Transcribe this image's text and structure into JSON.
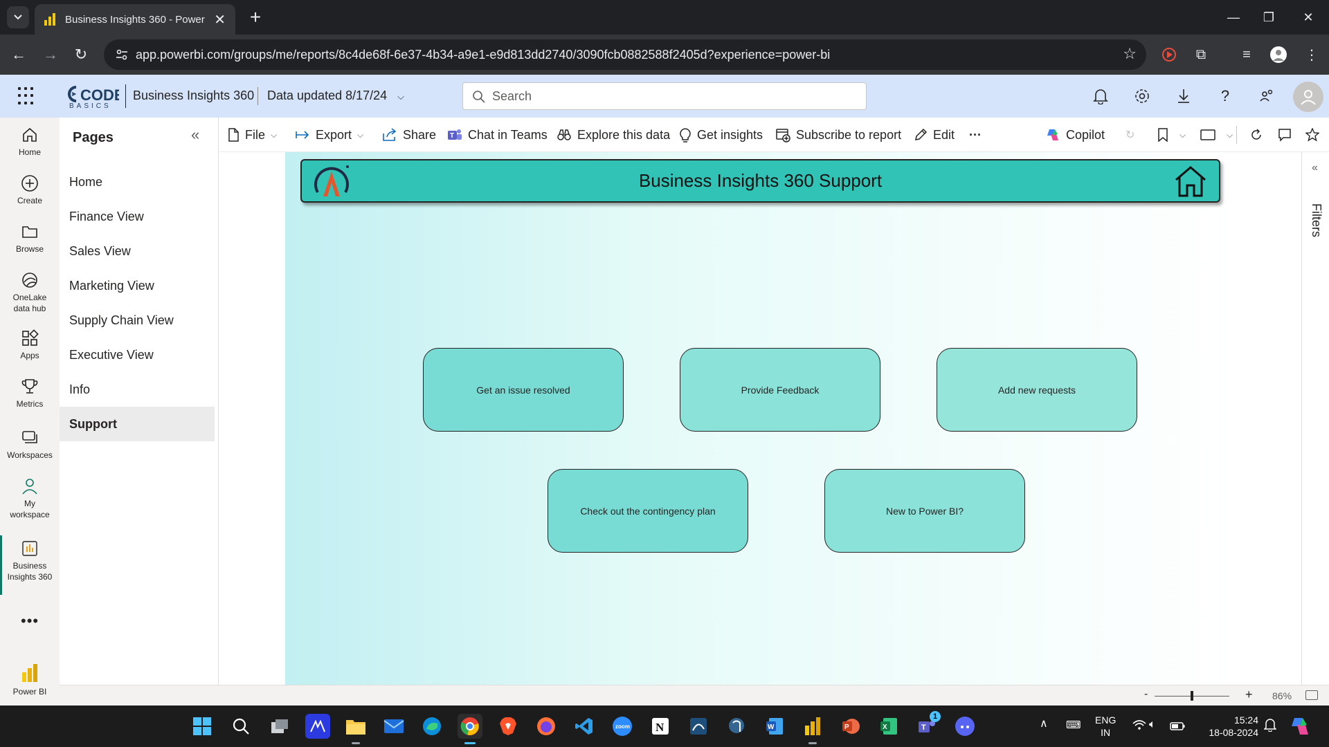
{
  "browser": {
    "tab_title": "Business Insights 360 - Power BI",
    "url": "app.powerbi.com/groups/me/reports/8c4de68f-6e37-4b34-a9e1-e9d813dd2740/3090fcb0882588f2405d?experience=power-bi"
  },
  "header": {
    "brand_text": "CODE",
    "brand_sub": "BASICS",
    "workspace_name": "Business Insights 360",
    "data_updated": "Data updated 8/17/24",
    "search_placeholder": "Search"
  },
  "navrail": {
    "items": [
      {
        "label": "Home",
        "icon": "home-icon"
      },
      {
        "label": "Create",
        "icon": "plus-circle-icon"
      },
      {
        "label": "Browse",
        "icon": "folder-icon"
      },
      {
        "label": "OneLake data hub",
        "icon": "onelake-icon"
      },
      {
        "label": "Apps",
        "icon": "apps-icon"
      },
      {
        "label": "Metrics",
        "icon": "trophy-icon"
      },
      {
        "label": "Workspaces",
        "icon": "workspaces-icon"
      },
      {
        "label": "My workspace",
        "icon": "person-icon"
      },
      {
        "label": "Business Insights 360",
        "icon": "report-icon"
      }
    ],
    "footer_label": "Power BI"
  },
  "pages": {
    "title": "Pages",
    "items": [
      {
        "label": "Home"
      },
      {
        "label": "Finance View"
      },
      {
        "label": "Sales View"
      },
      {
        "label": "Marketing View"
      },
      {
        "label": "Supply Chain View"
      },
      {
        "label": "Executive View"
      },
      {
        "label": "Info"
      },
      {
        "label": "Support",
        "active": true
      }
    ]
  },
  "actionbar": {
    "file": "File",
    "export": "Export",
    "share": "Share",
    "chat": "Chat in Teams",
    "explore": "Explore this data",
    "insights": "Get insights",
    "subscribe": "Subscribe to report",
    "edit": "Edit",
    "more": "···",
    "copilot": "Copilot"
  },
  "report": {
    "banner_title": "Business Insights 360 Support",
    "buttons": [
      {
        "label": "Get an issue resolved",
        "color": "#79dcd4"
      },
      {
        "label": "Provide Feedback",
        "color": "#8ae2d9"
      },
      {
        "label": "Add new requests",
        "color": "#96e5db"
      },
      {
        "label": "Check out the contingency plan",
        "color": "#79dcd4"
      },
      {
        "label": "New to Power BI?",
        "color": "#8ae2d9"
      }
    ],
    "colors": {
      "banner": "#32c3b7",
      "gradient_start": "#c2eff2",
      "gradient_end": "#ffffff"
    }
  },
  "filters": {
    "label": "Filters"
  },
  "statusbar": {
    "zoom_minus": "-",
    "zoom_plus": "+",
    "zoom_level": "86%",
    "zoom_fraction": 0.5
  },
  "taskbar": {
    "lang_line1": "ENG",
    "lang_line2": "IN",
    "time": "15:24",
    "date": "18-08-2024",
    "teams_badge": "1"
  }
}
